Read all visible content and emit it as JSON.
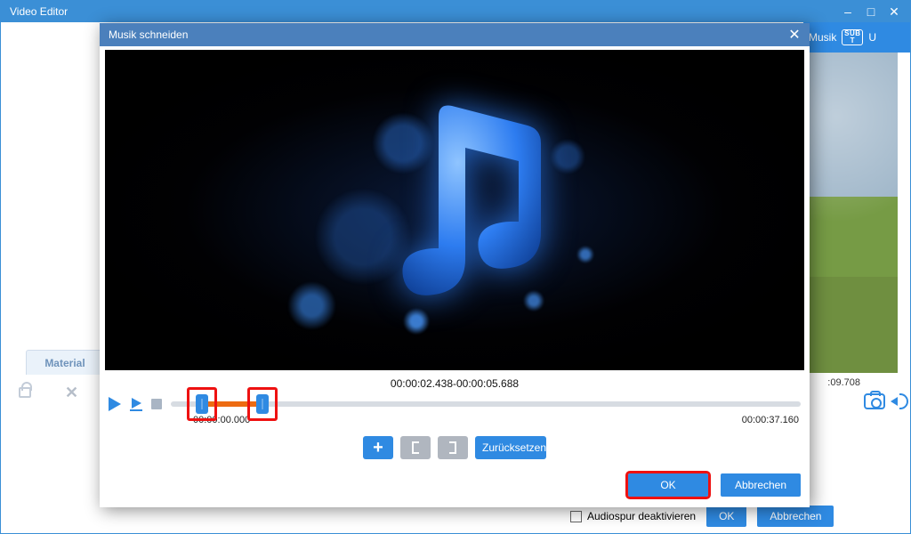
{
  "app": {
    "title": "Video Editor"
  },
  "main_toolstrip": {
    "musik_label": "Musik",
    "sub_top": "SUB",
    "sub_bot": "T",
    "u_label_fragment": "U"
  },
  "main": {
    "material_tab_label": "Material",
    "time_label": ":09.708",
    "deactivate_audio_label": "Audiospur deaktivieren",
    "ok_label": "OK",
    "cancel_label": "Abbrechen"
  },
  "modal": {
    "title": "Musik schneiden",
    "clip_range": "00:00:02.438-00:00:05.688",
    "start_time": "00:00:00.000",
    "end_time": "00:00:37.160",
    "reset_label": "Zurücksetzen",
    "ok_label": "OK",
    "cancel_label": "Abbrechen",
    "handle_left_pct": 5.0,
    "handle_right_pct": 14.5
  }
}
